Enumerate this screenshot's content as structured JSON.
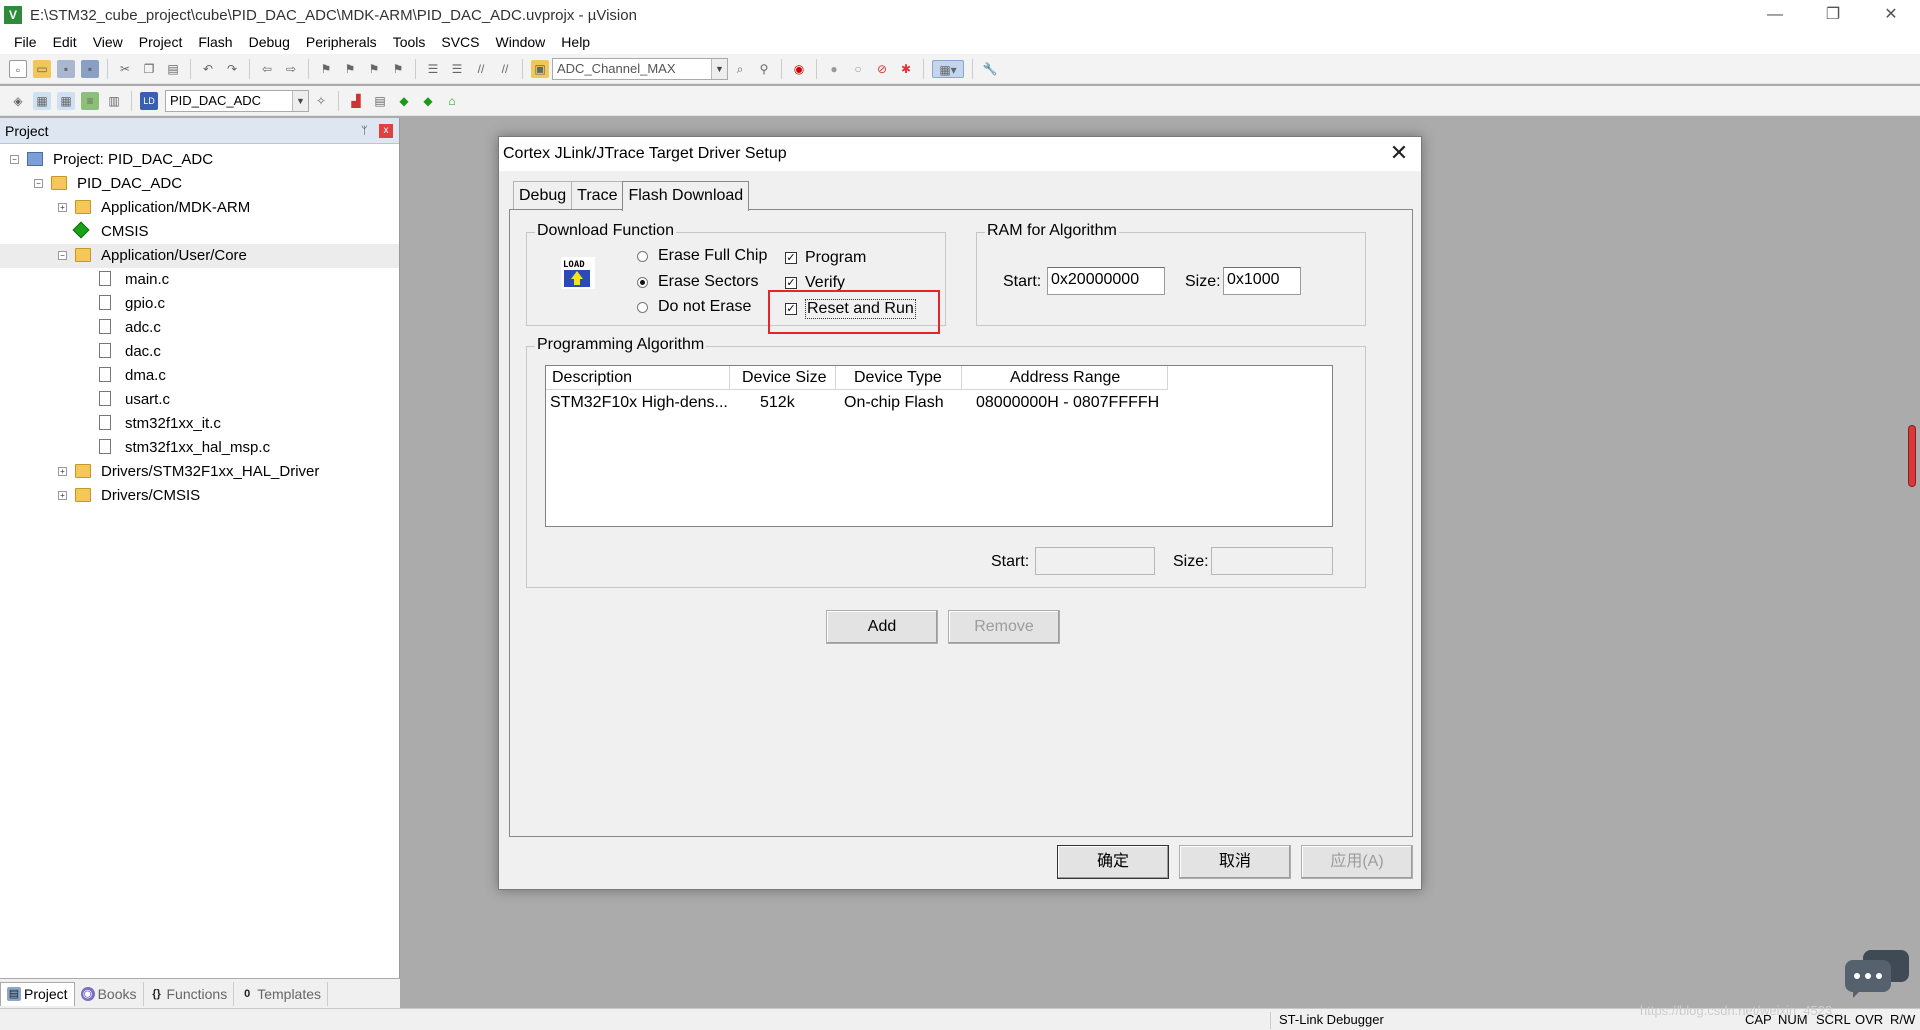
{
  "window": {
    "title": "E:\\STM32_cube_project\\cube\\PID_DAC_ADC\\MDK-ARM\\PID_DAC_ADC.uvprojx - µVision",
    "app_icon": "keil-uvision-icon",
    "minimize": "—",
    "restore": "❐",
    "close": "✕"
  },
  "menu": [
    "File",
    "Edit",
    "View",
    "Project",
    "Flash",
    "Debug",
    "Peripherals",
    "Tools",
    "SVCS",
    "Window",
    "Help"
  ],
  "toolbar": {
    "find_combo_value": "ADC_Channel_MAX",
    "target_combo_value": "PID_DAC_ADC"
  },
  "project_panel": {
    "title": "Project",
    "pin": "ᛘ",
    "close": "x",
    "tree": [
      {
        "label": "Project: PID_DAC_ADC",
        "icon": "project-icon",
        "level": 0,
        "expander": "−"
      },
      {
        "label": "PID_DAC_ADC",
        "icon": "target-folder-icon",
        "level": 1,
        "expander": "−"
      },
      {
        "label": "Application/MDK-ARM",
        "icon": "folder-icon",
        "level": 2,
        "expander": "+"
      },
      {
        "label": "CMSIS",
        "icon": "cmsis-diamond-icon",
        "level": 2,
        "expander": ""
      },
      {
        "label": "Application/User/Core",
        "icon": "folder-icon",
        "level": 2,
        "expander": "−",
        "selected": true
      },
      {
        "label": "main.c",
        "icon": "file-icon",
        "level": 3,
        "expander": ""
      },
      {
        "label": "gpio.c",
        "icon": "file-icon",
        "level": 3,
        "expander": ""
      },
      {
        "label": "adc.c",
        "icon": "file-icon",
        "level": 3,
        "expander": ""
      },
      {
        "label": "dac.c",
        "icon": "file-icon",
        "level": 3,
        "expander": ""
      },
      {
        "label": "dma.c",
        "icon": "file-icon",
        "level": 3,
        "expander": ""
      },
      {
        "label": "usart.c",
        "icon": "file-icon",
        "level": 3,
        "expander": ""
      },
      {
        "label": "stm32f1xx_it.c",
        "icon": "file-icon",
        "level": 3,
        "expander": ""
      },
      {
        "label": "stm32f1xx_hal_msp.c",
        "icon": "file-icon",
        "level": 3,
        "expander": ""
      },
      {
        "label": "Drivers/STM32F1xx_HAL_Driver",
        "icon": "folder-icon",
        "level": 2,
        "expander": "+"
      },
      {
        "label": "Drivers/CMSIS",
        "icon": "folder-icon",
        "level": 2,
        "expander": "+"
      }
    ],
    "tabs": [
      {
        "label": "Project",
        "glyph": "▤"
      },
      {
        "label": "Books",
        "glyph": "◉"
      },
      {
        "label": "Functions",
        "glyph": "{}"
      },
      {
        "label": "Templates",
        "glyph": "0"
      }
    ]
  },
  "dialog": {
    "title": "Cortex JLink/JTrace Target Driver Setup",
    "close": "✕",
    "tabs": [
      "Debug",
      "Trace",
      "Flash Download"
    ],
    "active_tab": "Flash Download",
    "download_function": {
      "title": "Download Function",
      "load_icon_text": "LOAD",
      "radios": [
        {
          "label": "Erase Full Chip",
          "checked": false
        },
        {
          "label": "Erase Sectors",
          "checked": true
        },
        {
          "label": "Do not Erase",
          "checked": false
        }
      ],
      "checks": [
        {
          "label": "Program",
          "checked": true
        },
        {
          "label": "Verify",
          "checked": true
        },
        {
          "label": "Reset and Run",
          "checked": true
        }
      ],
      "check_glyph": "✓"
    },
    "ram": {
      "title": "RAM for Algorithm",
      "start_label": "Start:",
      "start_value": "0x20000000",
      "size_label": "Size:",
      "size_value": "0x1000"
    },
    "programming_algorithm": {
      "title": "Programming Algorithm",
      "columns": [
        "Description",
        "Device Size",
        "Device Type",
        "Address Range"
      ],
      "rows": [
        [
          "STM32F10x High-dens...",
          "512k",
          "On-chip Flash",
          "08000000H - 0807FFFFH"
        ]
      ],
      "start_label": "Start:",
      "start_value": "",
      "size_label": "Size:",
      "size_value": ""
    },
    "add_button": "Add",
    "remove_button": "Remove",
    "ok_button": "确定",
    "cancel_button": "取消",
    "apply_button": "应用(A)"
  },
  "statusbar": {
    "debugger": "ST-Link Debugger",
    "indicators": [
      "CAP",
      "NUM",
      "SCRL",
      "OVR",
      "R/W"
    ],
    "watermark": "https://blog.csdn.net/weixin_4523..."
  },
  "colors": {
    "highlight_red": "#e3262a",
    "panel_header": "#dde6f1",
    "workspace": "#ababab"
  }
}
